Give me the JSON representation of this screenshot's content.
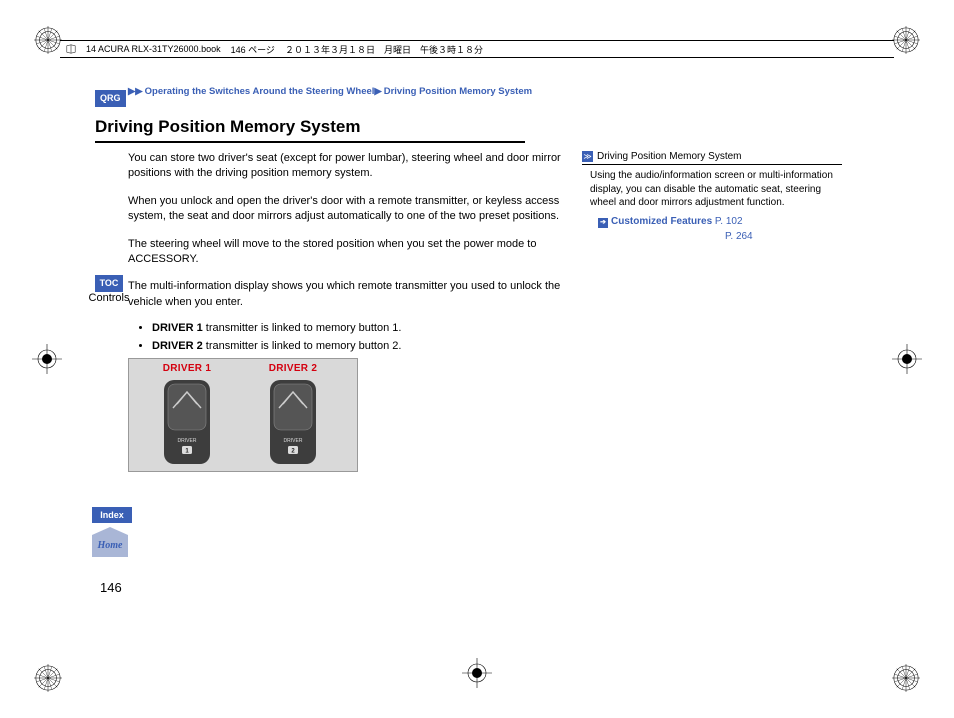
{
  "header": {
    "filename": "14 ACURA RLX-31TY26000.book",
    "page_label": "146 ページ",
    "date": "２０１３年３月１８日　月曜日　午後３時１８分"
  },
  "breadcrumb": {
    "section": "Operating the Switches Around the Steering Wheel",
    "subsection": "Driving Position Memory System"
  },
  "nav": {
    "qrg": "QRG",
    "toc": "TOC",
    "controls": "Controls",
    "index": "Index",
    "home": "Home"
  },
  "title": "Driving Position Memory System",
  "paragraphs": {
    "p1": "You can store two driver's seat (except for power lumbar), steering wheel and door mirror positions with the driving position memory system.",
    "p2": "When you unlock and open the driver's door with a remote transmitter, or keyless access system, the seat and door mirrors adjust automatically to one of the two preset positions.",
    "p3": "The steering wheel will move to the stored position when you set the power mode to ACCESSORY.",
    "p4": "The multi-information display shows you which remote transmitter you used to unlock the vehicle when you enter."
  },
  "bullets": {
    "b1_bold": "DRIVER 1",
    "b1_rest": " transmitter is linked to memory button 1.",
    "b2_bold": "DRIVER 2",
    "b2_rest": " transmitter is linked to memory button 2."
  },
  "fobs": {
    "d1": "DRIVER 1",
    "d2": "DRIVER 2"
  },
  "sidebar": {
    "heading": "Driving Position Memory System",
    "text": "Using the audio/information screen or multi-information display, you can disable the automatic seat, steering wheel and door mirrors adjustment function.",
    "link_label": "Customized Features",
    "pg1": "P. 102",
    "pg2": "P. 264"
  },
  "page_number": "146"
}
